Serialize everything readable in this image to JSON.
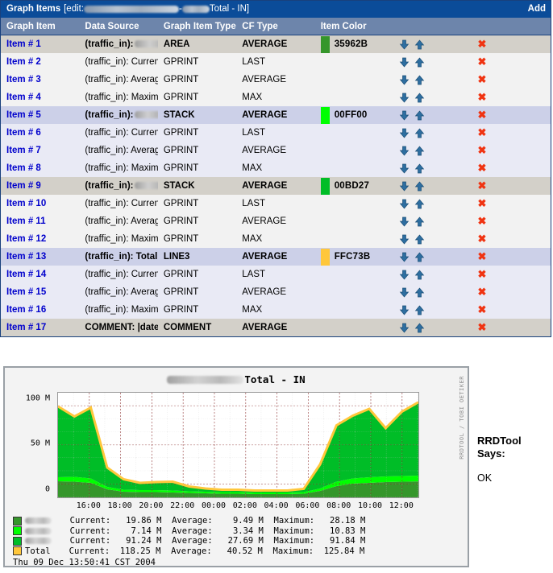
{
  "panel": {
    "title_strong": "Graph Items",
    "title_prefix": "[edit:",
    "title_sep": "-",
    "title_suffix": "Total - IN]",
    "add_label": "Add"
  },
  "table": {
    "columns": [
      "Graph Item",
      "Data Source",
      "Graph Item Type",
      "CF Type",
      "Item Color"
    ],
    "rows": [
      {
        "item": "Item # 1",
        "source": "(traffic_in):",
        "redacted": true,
        "hr": false,
        "type": "AREA",
        "cf": "AVERAGE",
        "color": "35962B",
        "swatch": "#35962B",
        "style": "grp-gray"
      },
      {
        "item": "Item # 2",
        "source": "(traffic_in): Current:",
        "redacted": false,
        "hr": false,
        "type": "GPRINT",
        "cf": "LAST",
        "color": "",
        "swatch": "",
        "style": "sub-light"
      },
      {
        "item": "Item # 3",
        "source": "(traffic_in): Average:",
        "redacted": false,
        "hr": false,
        "type": "GPRINT",
        "cf": "AVERAGE",
        "color": "",
        "swatch": "",
        "style": "sub-light"
      },
      {
        "item": "Item # 4",
        "source": "(traffic_in): Maximum:",
        "redacted": false,
        "hr": true,
        "type": "GPRINT",
        "cf": "MAX",
        "color": "",
        "swatch": "",
        "style": "sub-light"
      },
      {
        "item": "Item # 5",
        "source": "(traffic_in):",
        "redacted": true,
        "hr": false,
        "type": "STACK",
        "cf": "AVERAGE",
        "color": "00FF00",
        "swatch": "#00FF00",
        "style": "grp-lav"
      },
      {
        "item": "Item # 6",
        "source": "(traffic_in): Current:",
        "redacted": false,
        "hr": false,
        "type": "GPRINT",
        "cf": "LAST",
        "color": "",
        "swatch": "",
        "style": "sub-lav"
      },
      {
        "item": "Item # 7",
        "source": "(traffic_in): Average:",
        "redacted": false,
        "hr": false,
        "type": "GPRINT",
        "cf": "AVERAGE",
        "color": "",
        "swatch": "",
        "style": "sub-lav"
      },
      {
        "item": "Item # 8",
        "source": "(traffic_in): Maximum:",
        "redacted": false,
        "hr": true,
        "type": "GPRINT",
        "cf": "MAX",
        "color": "",
        "swatch": "",
        "style": "sub-lav"
      },
      {
        "item": "Item # 9",
        "source": "(traffic_in):",
        "redacted": true,
        "hr": false,
        "type": "STACK",
        "cf": "AVERAGE",
        "color": "00BD27",
        "swatch": "#00BD27",
        "style": "grp-gray"
      },
      {
        "item": "Item # 10",
        "source": "(traffic_in): Current:",
        "redacted": false,
        "hr": false,
        "type": "GPRINT",
        "cf": "LAST",
        "color": "",
        "swatch": "",
        "style": "sub-light"
      },
      {
        "item": "Item # 11",
        "source": "(traffic_in): Average:",
        "redacted": false,
        "hr": false,
        "type": "GPRINT",
        "cf": "AVERAGE",
        "color": "",
        "swatch": "",
        "style": "sub-light"
      },
      {
        "item": "Item # 12",
        "source": "(traffic_in): Maximum:",
        "redacted": false,
        "hr": true,
        "type": "GPRINT",
        "cf": "MAX",
        "color": "",
        "swatch": "",
        "style": "sub-light"
      },
      {
        "item": "Item # 13",
        "source": "(traffic_in): Total",
        "redacted": false,
        "hr": false,
        "type": "LINE3",
        "cf": "AVERAGE",
        "color": "FFC73B",
        "swatch": "#FFC73B",
        "style": "grp-lav"
      },
      {
        "item": "Item # 14",
        "source": "(traffic_in): Current:",
        "redacted": false,
        "hr": false,
        "type": "GPRINT",
        "cf": "LAST",
        "color": "",
        "swatch": "",
        "style": "sub-lav"
      },
      {
        "item": "Item # 15",
        "source": "(traffic_in): Average:",
        "redacted": false,
        "hr": false,
        "type": "GPRINT",
        "cf": "AVERAGE",
        "color": "",
        "swatch": "",
        "style": "sub-lav"
      },
      {
        "item": "Item # 16",
        "source": "(traffic_in): Maximum:",
        "redacted": false,
        "hr": true,
        "type": "GPRINT",
        "cf": "MAX",
        "color": "",
        "swatch": "",
        "style": "sub-lav"
      },
      {
        "item": "Item # 17",
        "source": "COMMENT: |date_time|",
        "redacted": false,
        "hr": false,
        "type": "COMMENT",
        "cf": "AVERAGE",
        "color": "",
        "swatch": "",
        "style": "grp-gray"
      }
    ],
    "hr_tag": "<HR>",
    "icons": {
      "move_down": "arrow-down-icon",
      "move_up": "arrow-up-icon",
      "delete": "delete-x-icon",
      "delete_glyph": "✖"
    }
  },
  "graph": {
    "title_suffix": "Total - IN",
    "watermark": "RRDTOOL / TOBI OETIKER",
    "ylabels": [
      "100 M",
      "50 M",
      "0"
    ],
    "xlabels": [
      "16:00",
      "18:00",
      "20:00",
      "22:00",
      "00:00",
      "02:00",
      "04:00",
      "06:00",
      "08:00",
      "10:00",
      "12:00"
    ],
    "legend": [
      {
        "swatch": "#35962B",
        "label": "",
        "redacted": true,
        "current": "19.86 M",
        "average": "9.49 M",
        "maximum": "28.18 M"
      },
      {
        "swatch": "#00FF00",
        "label": "",
        "redacted": true,
        "current": "7.14 M",
        "average": "3.34 M",
        "maximum": "10.83 M"
      },
      {
        "swatch": "#00BD27",
        "label": "",
        "redacted": true,
        "current": "91.24 M",
        "average": "27.69 M",
        "maximum": "91.84 M"
      },
      {
        "swatch": "#FFC73B",
        "label": "Total",
        "redacted": false,
        "current": "118.25 M",
        "average": "40.52 M",
        "maximum": "125.84 M"
      }
    ],
    "legend_keys": {
      "current": "Current:",
      "average": "Average:",
      "maximum": "Maximum:"
    },
    "timestamp": "Thu 09 Dec 13:50:41 CST 2004"
  },
  "rrdtool": {
    "says_line1": "RRDTool",
    "says_line2": "Says:",
    "status": "OK"
  },
  "chart_data": {
    "type": "area",
    "title": "Total - IN",
    "xlabel": "",
    "ylabel": "",
    "ylim": [
      0,
      130000000
    ],
    "ytick_labels": [
      "0",
      "50 M",
      "100 M"
    ],
    "grid": true,
    "legend_position": "bottom",
    "x": [
      "15:00",
      "16:00",
      "17:00",
      "18:00",
      "19:00",
      "20:00",
      "21:00",
      "22:00",
      "23:00",
      "00:00",
      "01:00",
      "02:00",
      "03:00",
      "04:00",
      "05:00",
      "06:00",
      "07:00",
      "08:00",
      "09:00",
      "10:00",
      "11:00",
      "12:00",
      "13:00"
    ],
    "series": [
      {
        "name": "series-1",
        "color": "#35962B",
        "stack": true,
        "values": [
          20.0,
          19.5,
          18.0,
          10.0,
          7.0,
          6.5,
          6.5,
          6.0,
          5.5,
          5.0,
          4.5,
          4.5,
          4.0,
          4.0,
          4.0,
          4.5,
          8.0,
          14.0,
          17.0,
          18.0,
          19.0,
          19.5,
          19.86
        ],
        "units": "M",
        "current": 19.86,
        "average": 9.49,
        "maximum": 28.18
      },
      {
        "name": "series-2",
        "color": "#00FF00",
        "stack": true,
        "values": [
          5.0,
          6.0,
          5.5,
          3.0,
          2.5,
          2.5,
          2.5,
          2.5,
          2.0,
          2.0,
          2.0,
          2.0,
          2.0,
          2.0,
          2.0,
          2.0,
          3.0,
          5.5,
          6.5,
          7.0,
          7.0,
          7.0,
          7.14
        ],
        "units": "M",
        "current": 7.14,
        "average": 3.34,
        "maximum": 10.83
      },
      {
        "name": "series-3",
        "color": "#00BD27",
        "stack": true,
        "values": [
          88.0,
          75.0,
          88.0,
          24.0,
          13.0,
          9.0,
          10.0,
          11.0,
          6.0,
          4.0,
          3.0,
          3.0,
          2.5,
          2.5,
          2.5,
          4.0,
          30.0,
          70.0,
          78.0,
          85.0,
          60.0,
          80.0,
          91.24
        ],
        "units": "M",
        "current": 91.24,
        "average": 27.69,
        "maximum": 91.84
      }
    ],
    "total_line": {
      "name": "Total",
      "color": "#FFC73B",
      "type": "line",
      "linewidth": 3,
      "values": [
        113.0,
        100.5,
        111.5,
        37.0,
        22.5,
        18.0,
        19.0,
        19.5,
        13.5,
        11.0,
        9.5,
        9.5,
        8.5,
        8.5,
        8.5,
        10.5,
        41.0,
        89.5,
        101.5,
        110.0,
        86.0,
        106.5,
        118.25
      ],
      "units": "M",
      "current": 118.25,
      "average": 40.52,
      "maximum": 125.84
    }
  }
}
